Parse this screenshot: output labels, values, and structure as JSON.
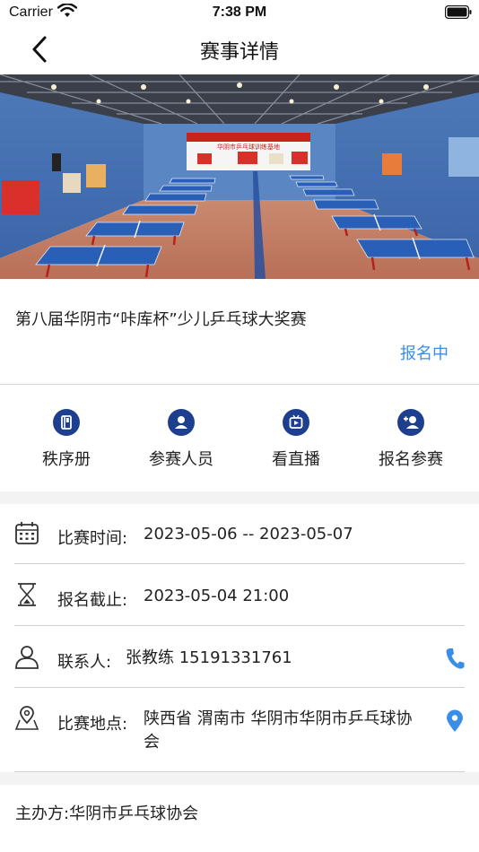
{
  "status_bar": {
    "carrier": "Carrier",
    "time": "7:38 PM"
  },
  "nav": {
    "title": "赛事详情"
  },
  "event": {
    "title": "第八届华阴市“咔库杯”少儿乒乓球大奖赛",
    "status": "报名中",
    "banner_sign": "华阴市乒乓球训练基地"
  },
  "actions": [
    {
      "label": "秩序册",
      "icon": "book-icon"
    },
    {
      "label": "参赛人员",
      "icon": "person-icon"
    },
    {
      "label": "看直播",
      "icon": "live-video-icon"
    },
    {
      "label": "报名参赛",
      "icon": "add-person-icon"
    }
  ],
  "info": {
    "time_label": "比赛时间:",
    "time_value": "2023-05-06 -- 2023-05-07",
    "deadline_label": "报名截止:",
    "deadline_value": "2023-05-04 21:00",
    "contact_label": "联系人:",
    "contact_value": "张教练 15191331761",
    "location_label": "比赛地点:",
    "location_value": "陕西省 渭南市 华阴市华阴市乒乓球协会"
  },
  "organizer": "主办方:华阴市乒乓球协会",
  "colors": {
    "accent": "#3a8ee6",
    "icon_bg": "#1e3f8f",
    "divider": "#d0d0d0"
  }
}
